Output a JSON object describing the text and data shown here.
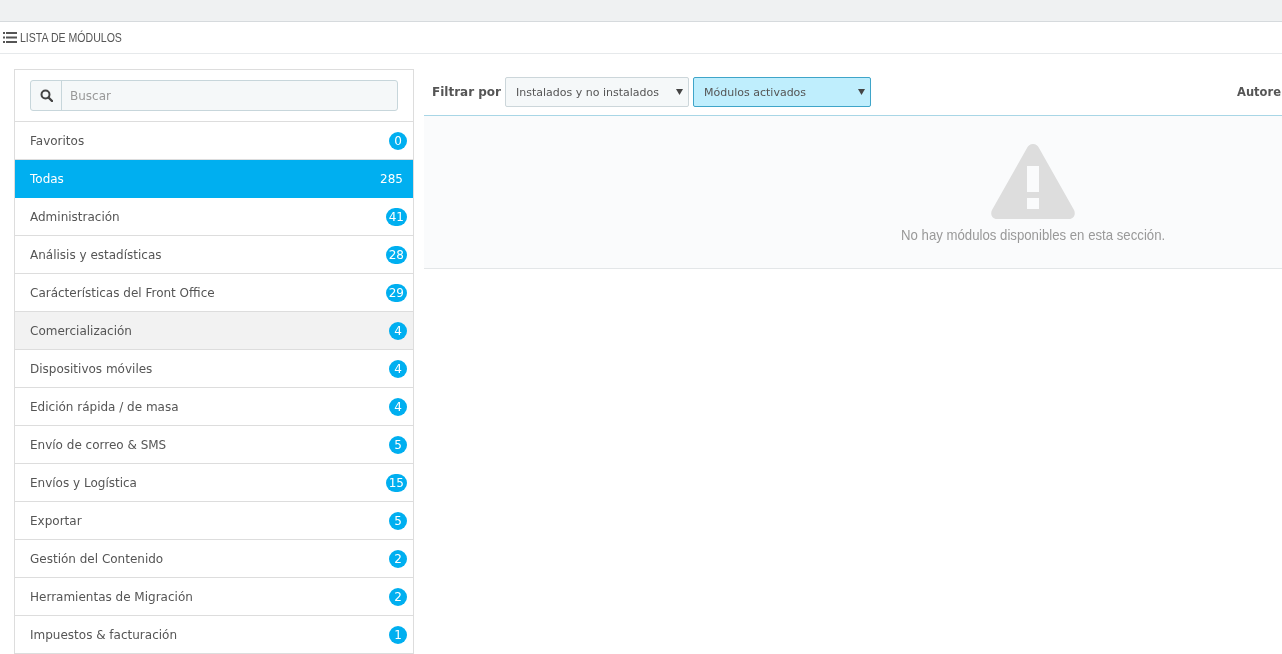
{
  "header": {
    "title": "LISTA DE MÓDULOS"
  },
  "search": {
    "placeholder": "Buscar"
  },
  "categories": [
    {
      "label": "Favoritos",
      "count": "0",
      "selected": false,
      "hovered": false
    },
    {
      "label": "Todas",
      "count": "285",
      "selected": true,
      "hovered": false
    },
    {
      "label": "Administración",
      "count": "41",
      "selected": false,
      "hovered": false
    },
    {
      "label": "Análisis y estadísticas",
      "count": "28",
      "selected": false,
      "hovered": false
    },
    {
      "label": "Carácterísticas del Front Office",
      "count": "29",
      "selected": false,
      "hovered": false
    },
    {
      "label": "Comercialización",
      "count": "4",
      "selected": false,
      "hovered": true
    },
    {
      "label": "Dispositivos móviles",
      "count": "4",
      "selected": false,
      "hovered": false
    },
    {
      "label": "Edición rápida / de masa",
      "count": "4",
      "selected": false,
      "hovered": false
    },
    {
      "label": "Envío de correo & SMS",
      "count": "5",
      "selected": false,
      "hovered": false
    },
    {
      "label": "Envíos y Logística",
      "count": "15",
      "selected": false,
      "hovered": false
    },
    {
      "label": "Exportar",
      "count": "5",
      "selected": false,
      "hovered": false
    },
    {
      "label": "Gestión del Contenido",
      "count": "2",
      "selected": false,
      "hovered": false
    },
    {
      "label": "Herramientas de Migración",
      "count": "2",
      "selected": false,
      "hovered": false
    },
    {
      "label": "Impuestos & facturación",
      "count": "1",
      "selected": false,
      "hovered": false
    }
  ],
  "filter": {
    "label": "Filtrar por",
    "dropdowns": [
      {
        "value": "Instalados y no instalados",
        "focused": false
      },
      {
        "value": "Módulos activados",
        "focused": true
      }
    ],
    "author_label": "Autore"
  },
  "empty_state": {
    "message": "No hay módulos disponibles en esta sección."
  }
}
